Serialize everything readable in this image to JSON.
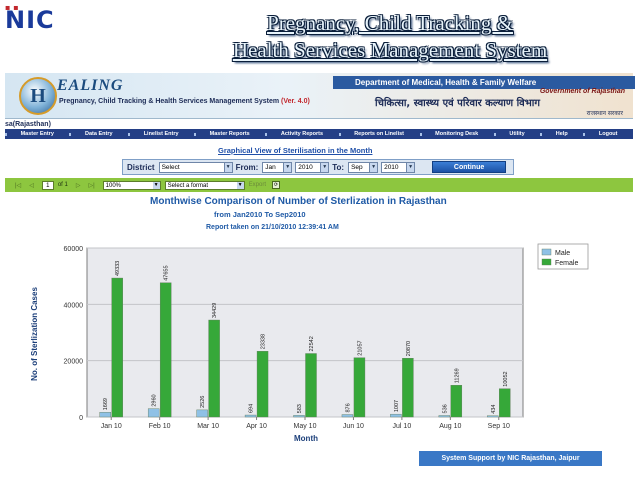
{
  "slide": {
    "logo_text": "NIC",
    "title_line1": "Pregnancy, Child Tracking & ",
    "title_line2": "Health Services Management System"
  },
  "banner": {
    "logo_letter": "H",
    "brand": "EALING",
    "system_name": "Pregnancy, Child Tracking & Health Services Management System",
    "version": "(Ver. 4.0)",
    "department": "Department of Medical, Health & Family Welfare",
    "government": "Government of Rajasthan",
    "hindi_department": "चिकित्सा, स्वास्थ्य एवं परिवार कल्याण विभाग",
    "hindi_government": "राजस्थान सरकार"
  },
  "user_label": "sa(Rajasthan)",
  "menu": [
    "Master Entry",
    "Data Entry",
    "Linelist Entry",
    "Master Reports",
    "Activity Reports",
    "Reports on Linelist",
    "Monitoring Desk",
    "Utility",
    "Help",
    "Logout"
  ],
  "filters": {
    "section_title": "Graphical View of Sterilisation in the Month",
    "district_label": "District",
    "district_value": "Select",
    "from_label": "From:",
    "from_month": "Jan",
    "from_year": "2010",
    "to_label": "To:",
    "to_month": "Sep",
    "to_year": "2010",
    "continue_label": "Continue"
  },
  "toolbar": {
    "first_icon": "|◁",
    "prev_icon": "◁",
    "page": "1",
    "page_of": "of 1",
    "next_icon": "▷",
    "last_icon": "▷|",
    "zoom": "100%",
    "format": "Select a format",
    "export": "Export",
    "refresh_icon": "⟳"
  },
  "report": {
    "title": "Monthwise Comparison of Number of Sterlization in Rajasthan",
    "range": "from Jan2010 To Sep2010",
    "taken": "Report taken on 21/10/2010 12:39:41 AM"
  },
  "chart_data": {
    "type": "bar",
    "xlabel": "Month",
    "ylabel": "No. of Sterlization Cases",
    "ylim": [
      0,
      60000
    ],
    "yticks": [
      0,
      20000,
      40000,
      60000
    ],
    "categories": [
      "Jan 10",
      "Feb 10",
      "Mar 10",
      "Apr 10",
      "May 10",
      "Jun 10",
      "Jul 10",
      "Aug 10",
      "Sep 10"
    ],
    "legend_position": "top-right",
    "grid": true,
    "series": [
      {
        "name": "Male",
        "color": "#8fc1e6",
        "values": [
          1669,
          2960,
          2526,
          694,
          583,
          876,
          1007,
          536,
          434
        ]
      },
      {
        "name": "Female",
        "color": "#36a839",
        "values": [
          49333,
          47655,
          34429,
          23338,
          22542,
          21057,
          20870,
          11269,
          10052
        ]
      }
    ]
  },
  "footer": "System Support by NIC Rajasthan, Jaipur"
}
